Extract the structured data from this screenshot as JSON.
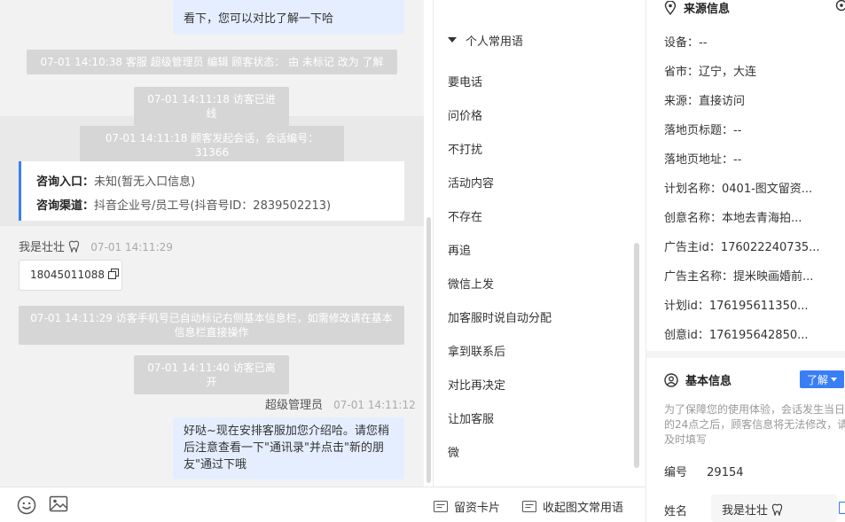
{
  "chat": {
    "top_bubble_text": "看下，您可以对比了解一下哈",
    "sys_status_change": "07-01 14:10:38 客服 超级管理员 编辑 顾客状态： 由 未标记 改为 了解",
    "sys_visitor_enter": "07-01 14:11:18 访客已进线",
    "sys_session_start": "07-01 14:11:18 顾客发起会话，会话编号：31366",
    "consult_entry_label": "咨询入口：",
    "consult_entry_value": "未知(暂无入口信息)",
    "consult_channel_label": "咨询渠道：",
    "consult_channel_value": "抖音企业号/员工号(抖音号ID：2839502213)",
    "visitor_name": "我是壮壮",
    "visitor_time": "07-01 14:11:29",
    "phone_number": "18045011088",
    "sys_phone_marked": "07-01 14:11:29 访客手机号已自动标记右侧基本信息栏，如需修改请在基本信息栏直接操作",
    "sys_visitor_leave": "07-01 14:11:40 访客已离开",
    "agent_name": "超级管理员",
    "agent_time": "07-01 14:11:12",
    "agent_message": "好哒~现在安排客服加您介绍哈。请您稍后注意查看一下\"通讯录\"并点击\"新的朋友\"通过下哦"
  },
  "toolbar": {
    "emoji_icon": "smile-icon",
    "image_icon": "image-icon",
    "card_label": "留资卡片",
    "collapse_label": "收起图文常用语"
  },
  "phrases": {
    "header": "个人常用语",
    "items": [
      "要电话",
      "问价格",
      "不打扰",
      "活动内容",
      "不存在",
      "再追",
      "微信上发",
      "加客服时说自动分配",
      "拿到联系后",
      "对比再决定",
      "让加客服",
      "微"
    ]
  },
  "info": {
    "source_title": "来源信息",
    "fields": [
      "设备：--",
      "省市：辽宁，大连",
      "来源：直接访问",
      "落地页标题：--",
      "落地页地址：--",
      "计划名称：0401-图文留资...",
      "创意名称：本地去青海拍...",
      "广告主id：176022240735...",
      "广告主名称：提米映画婚前...",
      "计划id：176195611350...",
      "创意id：176195642850..."
    ],
    "basic_title": "基本信息",
    "learn_label": "了解",
    "notice": "为了保障您的使用体验，会话发生当日的24点之后，顾客信息将无法修改，请及时填写",
    "id_label": "编号",
    "id_value": "29154",
    "name_label": "姓名",
    "name_value": "我是壮壮"
  },
  "colors": {
    "accent": "#3a7ef5",
    "bubble": "#e5eeff",
    "system_msg": "#d6d6d6"
  }
}
